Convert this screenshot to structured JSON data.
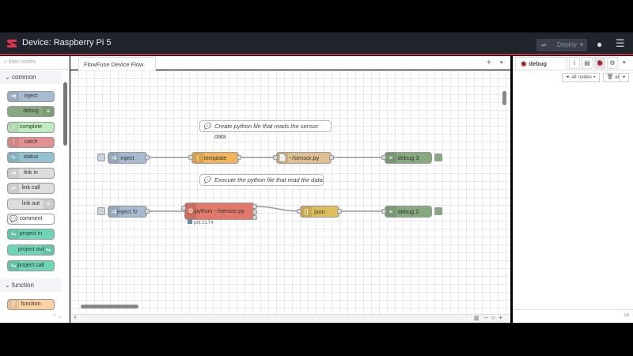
{
  "header": {
    "title": "Device: Raspberry Pi 5",
    "deploy_label": "Deploy"
  },
  "palette": {
    "filter_placeholder": "filter nodes",
    "categories": [
      {
        "label": "common"
      },
      {
        "label": "function"
      }
    ],
    "nodes": [
      {
        "label": "inject",
        "color": "#a6bbcf"
      },
      {
        "label": "debug",
        "color": "#87a980"
      },
      {
        "label": "complete",
        "color": "#c0edc0"
      },
      {
        "label": "catch",
        "color": "#e49191"
      },
      {
        "label": "status",
        "color": "#94c1d0"
      },
      {
        "label": "link in",
        "color": "#dddddd"
      },
      {
        "label": "link call",
        "color": "#dddddd"
      },
      {
        "label": "link out",
        "color": "#dddddd"
      },
      {
        "label": "comment",
        "color": "#ffffff"
      },
      {
        "label": "project in",
        "color": "#6fd3b8"
      },
      {
        "label": "project out",
        "color": "#6fd3b8"
      },
      {
        "label": "project call",
        "color": "#6fd3b8"
      },
      {
        "label": "function",
        "color": "#fdd0a2"
      }
    ]
  },
  "workspace": {
    "tab_label": "FlowFuse Device Flow",
    "comments": [
      "Create python file that reads the sensor data",
      "Execute the python file that read the data"
    ],
    "nodes": [
      {
        "label": "inject",
        "color": "#a6bbcf"
      },
      {
        "label": "template",
        "color": "#f0b45a"
      },
      {
        "label": "~/sensor.py",
        "color": "#debf8f"
      },
      {
        "label": "debug 3",
        "color": "#87a980"
      },
      {
        "label": "inject ↻",
        "color": "#a6bbcf"
      },
      {
        "label": "python ~/sensor.py",
        "color": "#e2796a"
      },
      {
        "label": "json",
        "color": "#debd5c"
      },
      {
        "label": "debug 2",
        "color": "#87a980"
      }
    ],
    "status_text": "pid:2174"
  },
  "sidebar": {
    "tab_label": "debug",
    "filter_label": "all nodes",
    "clear_label": "all"
  }
}
